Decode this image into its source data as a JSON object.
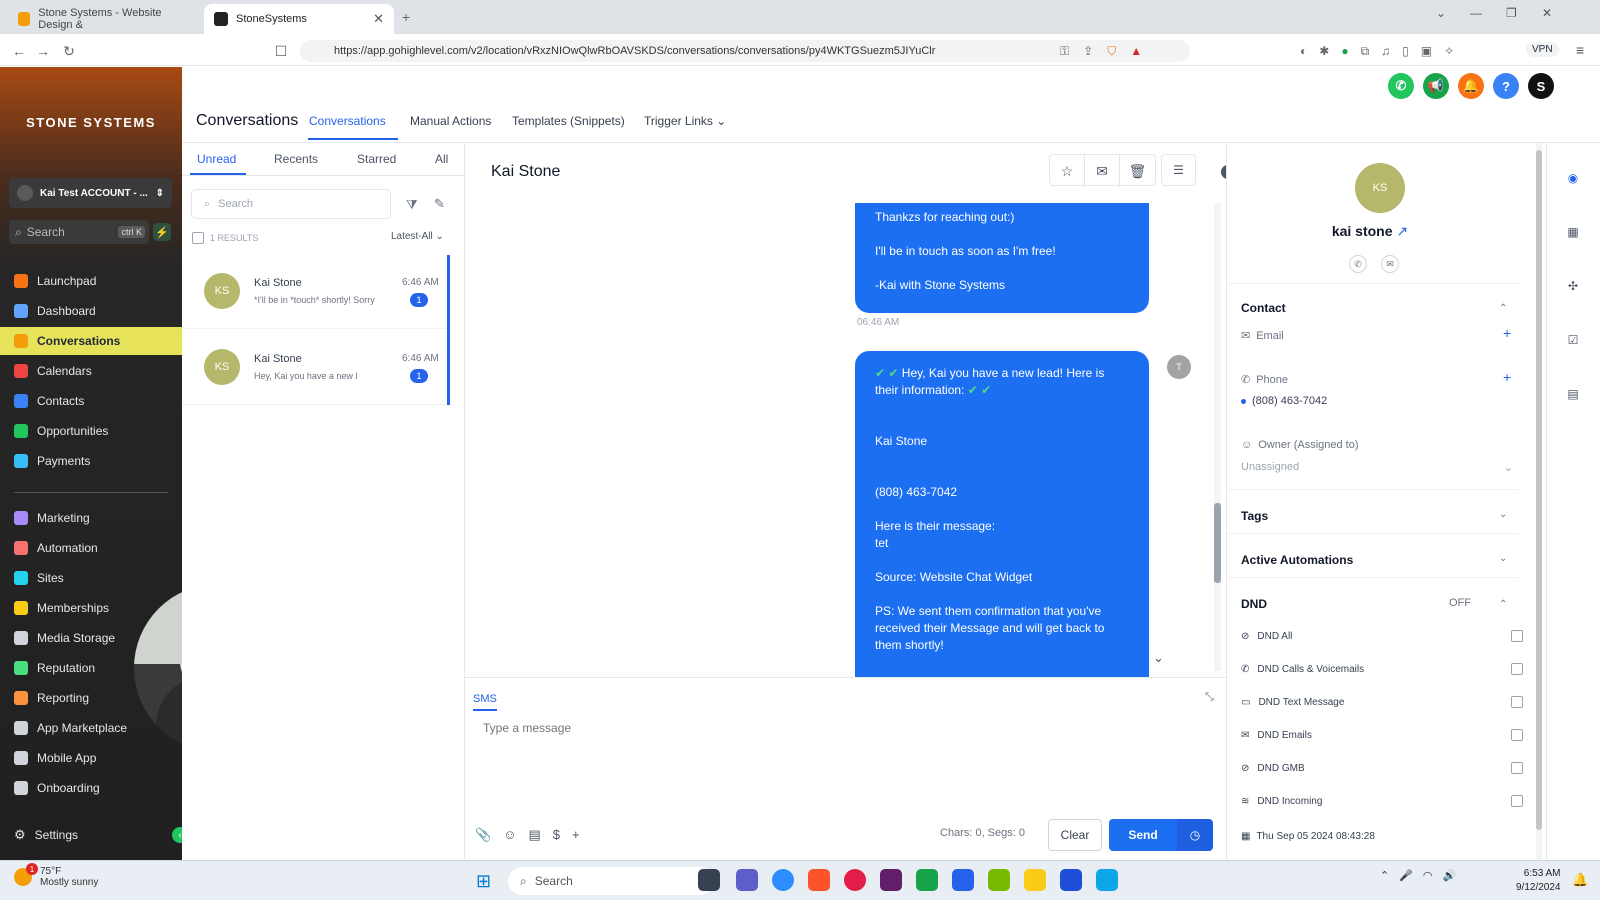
{
  "browser": {
    "tabs": [
      {
        "title": "Stone Systems - Website Design &"
      },
      {
        "title": "StoneSystems"
      }
    ],
    "url": "https://app.gohighlevel.com/v2/location/vRxzNIOwQlwRbOAVSKDS/conversations/conversations/py4WKTGSuezm5JIYuClr",
    "vpn_label": "VPN"
  },
  "sidebar": {
    "logo": "STONE SYSTEMS",
    "account": "Kai Test ACCOUNT - ...",
    "search_placeholder": "Search",
    "search_shortcut": "ctrl K",
    "items": [
      {
        "label": "Launchpad",
        "color": "#f97316"
      },
      {
        "label": "Dashboard",
        "color": "#60a5fa"
      },
      {
        "label": "Conversations",
        "color": "#f59e0b"
      },
      {
        "label": "Calendars",
        "color": "#ef4444"
      },
      {
        "label": "Contacts",
        "color": "#3b82f6"
      },
      {
        "label": "Opportunities",
        "color": "#22c55e"
      },
      {
        "label": "Payments",
        "color": "#38bdf8"
      }
    ],
    "items2": [
      {
        "label": "Marketing",
        "color": "#a78bfa"
      },
      {
        "label": "Automation",
        "color": "#f87171"
      },
      {
        "label": "Sites",
        "color": "#22d3ee"
      },
      {
        "label": "Memberships",
        "color": "#facc15"
      },
      {
        "label": "Media Storage",
        "color": "#d1d5db"
      },
      {
        "label": "Reputation",
        "color": "#4ade80"
      },
      {
        "label": "Reporting",
        "color": "#fb923c"
      },
      {
        "label": "App Marketplace",
        "color": "#d1d5db"
      },
      {
        "label": "Mobile App",
        "color": "#d1d5db"
      },
      {
        "label": "Onboarding",
        "color": "#d1d5db"
      }
    ],
    "settings_label": "Settings",
    "active_color": "#e6e25a"
  },
  "header": {
    "title": "Conversations",
    "tabs": [
      "Conversations",
      "Manual Actions",
      "Templates (Snippets)",
      "Trigger Links"
    ]
  },
  "list": {
    "tabs": [
      "Unread",
      "Recents",
      "Starred",
      "All"
    ],
    "search_placeholder": "Search",
    "results": "1 RESULTS",
    "sort": "Latest-All",
    "conversations": [
      {
        "initials": "KS",
        "name": "Kai Stone",
        "time": "6:46 AM",
        "snippet": "*I'll be in *touch* shortly! Sorry",
        "badge": "1"
      },
      {
        "initials": "KS",
        "name": "Kai Stone",
        "time": "6:46 AM",
        "snippet": "Hey, Kai you have a new l",
        "badge": "1"
      }
    ]
  },
  "chat": {
    "contact_name": "Kai Stone",
    "message1": {
      "lines": [
        "Thankzs for reaching out:)",
        "I'll be in touch as soon as I'm free!",
        "-Kai with Stone Systems"
      ],
      "time": "06:46 AM"
    },
    "message2": {
      "lines": [
        "Hey, Kai you have a new lead! Here is their information:",
        "Kai Stone",
        "(808) 463-7042",
        "Here is their message:",
        "tet",
        "Source: Website Chat Widget",
        "PS: We sent them confirmation that you've received their Message and will get back to them shortly!"
      ],
      "avatar": "T"
    },
    "channel": "SMS",
    "input_placeholder": "Type a message",
    "chars_label": "Chars: 0, Segs: 0",
    "clear_label": "Clear",
    "send_label": "Send",
    "bubble_color": "#1d6ff2"
  },
  "contact": {
    "initials": "KS",
    "name": "kai stone",
    "section_contact": "Contact",
    "email_label": "Email",
    "phone_label": "Phone",
    "phone_value": "(808) 463-7042",
    "owner_label": "Owner (Assigned to)",
    "owner_value": "Unassigned",
    "tags_label": "Tags",
    "automations_label": "Active Automations",
    "dnd_label": "DND",
    "dnd_status": "OFF",
    "dnd_items": [
      "DND All",
      "DND Calls & Voicemails",
      "DND Text Message",
      "DND Emails",
      "DND GMB",
      "DND Incoming"
    ],
    "timestamp": "Thu Sep 05 2024 08:43:28"
  },
  "taskbar": {
    "weather_temp": "75°F",
    "weather_desc": "Mostly sunny",
    "weather_badge": "1",
    "search": "Search",
    "time": "6:53 AM",
    "date": "9/12/2024"
  }
}
